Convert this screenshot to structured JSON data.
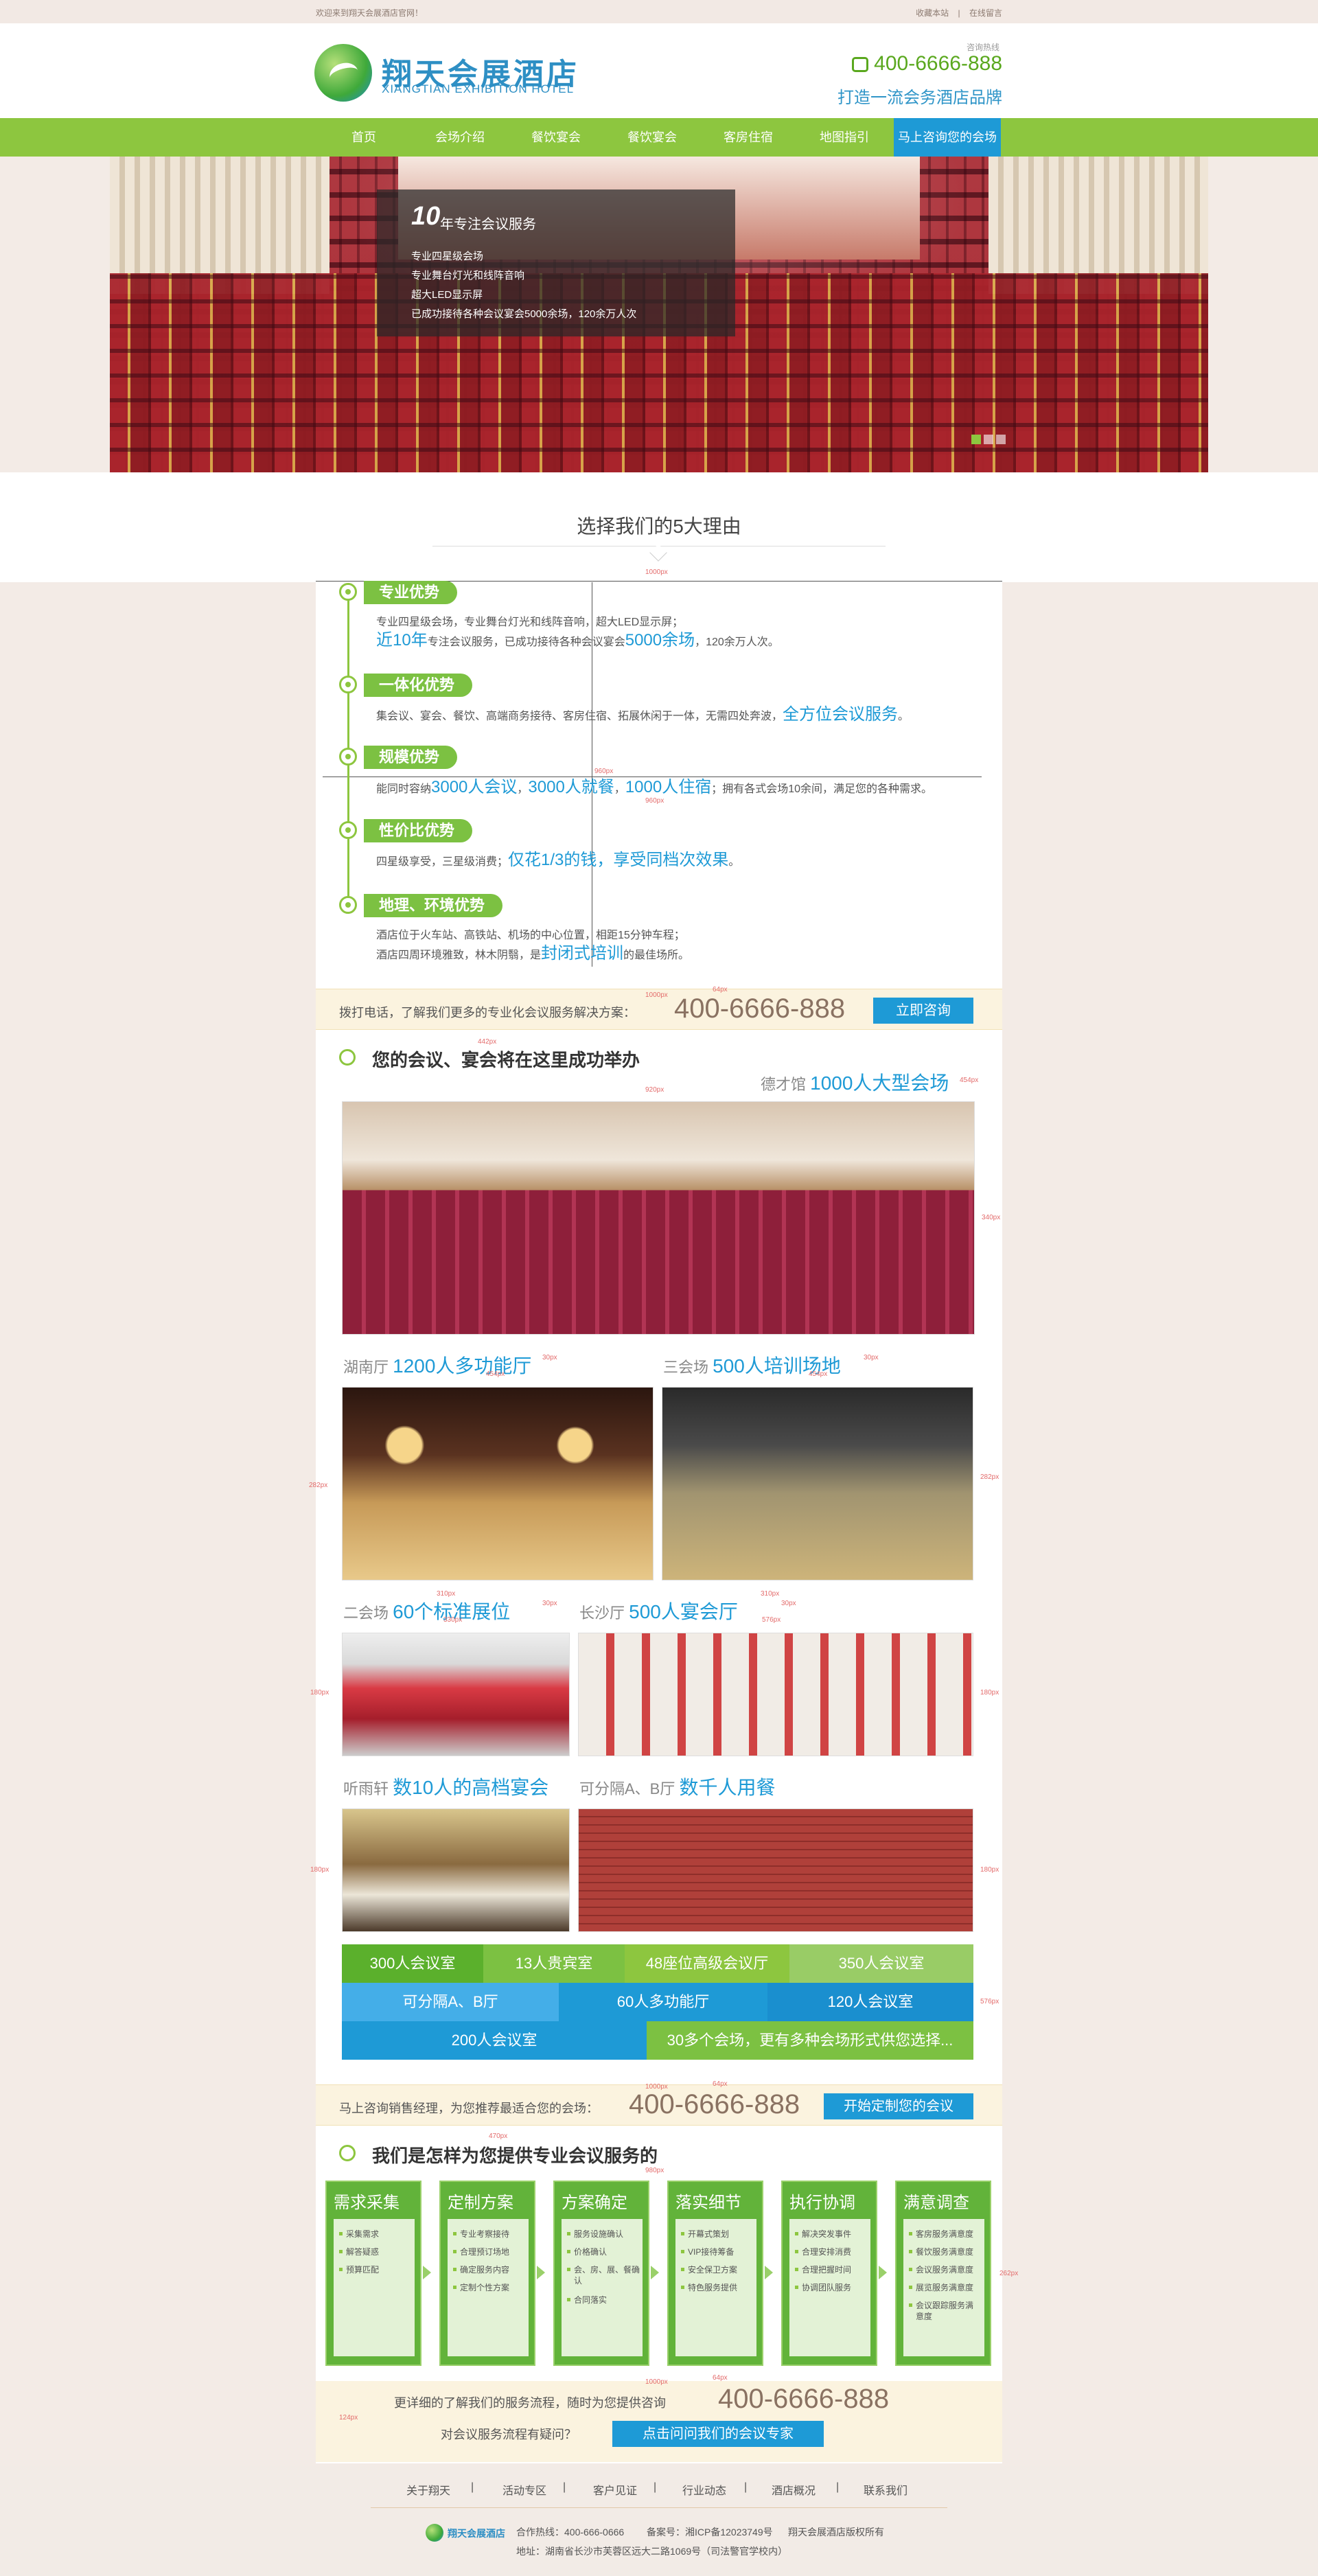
{
  "topbar": {
    "welcome": "欢迎来到翔天会展酒店官网！",
    "bookmark": "收藏本站",
    "sep": "|",
    "online": "在线留言"
  },
  "header": {
    "logo_cn": "翔天会展酒店",
    "logo_en": "XIANGTIAN EXHIBITION HOTEL",
    "hotline_label": "咨询热线",
    "hotline": "400-6666-888",
    "slogan": "打造一流会务酒店品牌"
  },
  "nav": [
    {
      "label": "首页"
    },
    {
      "label": "会场介绍"
    },
    {
      "label": "餐饮宴会"
    },
    {
      "label": "餐饮宴会"
    },
    {
      "label": "客房住宿"
    },
    {
      "label": "地图指引"
    },
    {
      "label": "马上咨询您的会场"
    }
  ],
  "banner": {
    "big": "10",
    "title": "年专注会议服务",
    "lines": [
      "专业四星级会场",
      "专业舞台灯光和线阵音响",
      "超大LED显示屏",
      "已成功接待各种会议宴会5000余场，120余万人次"
    ]
  },
  "reasons": {
    "title": "选择我们的5大理由",
    "items": [
      {
        "tag": "专业优势",
        "l1": "专业四星级会场，专业舞台灯光和线阵音响，超大LED显示屏；",
        "l2a": "近10年",
        "l2b": "专注会议服务，已成功接待各种会议宴会",
        "l2c": "5000余场",
        "l2d": "，120余万人次。"
      },
      {
        "tag": "一体化优势",
        "l1a": "集会议、宴会、餐饮、高端商务接待、客房住宿、拓展休闲于一体，无需四处奔波，",
        "l1b": "全方位会议服务",
        "l1c": "。"
      },
      {
        "tag": "规模优势",
        "l1a": "能同时容纳",
        "l1b": "3000人会议",
        "l1c": "，",
        "l1d": "3000人就餐",
        "l1e": "，",
        "l1f": "1000人住宿",
        "l1g": "；拥有各式会场10余间，满足您的各种需求。"
      },
      {
        "tag": "性价比优势",
        "l1a": "四星级享受，三星级消费；",
        "l1b": "仅花1/3的钱，享受同档次效果",
        "l1c": "。"
      },
      {
        "tag": "地理、环境优势",
        "l1": "酒店位于火车站、高铁站、机场的中心位置，相距15分钟车程；",
        "l2a": "酒店四周环境雅致，林木阴翳，是",
        "l2b": "封闭式培训",
        "l2c": "的最佳场所。"
      }
    ]
  },
  "strip1": {
    "text": "拨打电话，了解我们更多的专业化会议服务解决方案：",
    "num": "400-6666-888",
    "btn": "立即咨询"
  },
  "venues": {
    "title": "您的会议、宴会将在这里成功举办",
    "main": {
      "name": "德才馆",
      "desc": "1000人大型会场"
    },
    "v1": {
      "name": "湖南厅",
      "desc": "1200人多功能厅"
    },
    "v2": {
      "name": "三会场",
      "desc": "500人培训场地"
    },
    "v3": {
      "name": "二会场",
      "desc": "60个标准展位"
    },
    "v4": {
      "name": "长沙厅",
      "desc": "500人宴会厅"
    },
    "v5": {
      "name": "听雨轩",
      "desc": "数10人的高档宴会"
    },
    "v6": {
      "name": "可分隔A、B厅",
      "desc": "数千人用餐"
    },
    "grid": [
      [
        "300人会议室",
        "13人贵宾室",
        "48座位高级会议厅",
        "350人会议室"
      ],
      [
        "可分隔A、B厅",
        "60人多功能厅",
        "120人会议室"
      ],
      [
        "200人会议室",
        "30多个会场，更有多种会场形式供您选择..."
      ]
    ]
  },
  "strip2": {
    "text": "马上咨询销售经理，为您推荐最适合您的会场：",
    "num": "400-6666-888",
    "btn": "开始定制您的会议"
  },
  "process": {
    "title": "我们是怎样为您提供专业会议服务的",
    "steps": [
      {
        "h": "需求采集",
        "items": [
          "采集需求",
          "解答疑惑",
          "预算匹配"
        ]
      },
      {
        "h": "定制方案",
        "items": [
          "专业考察接待",
          "合理预订场地",
          "确定服务内容",
          "定制个性方案"
        ]
      },
      {
        "h": "方案确定",
        "items": [
          "服务设施确认",
          "价格确认",
          "会、房、展、餐确认",
          "合同落实"
        ]
      },
      {
        "h": "落实细节",
        "items": [
          "开幕式策划",
          "VIP接待筹备",
          "安全保卫方案",
          "特色服务提供"
        ]
      },
      {
        "h": "执行协调",
        "items": [
          "解决突发事件",
          "合理安排消费",
          "合理把握时间",
          "协调团队服务"
        ]
      },
      {
        "h": "满意调查",
        "items": [
          "客房服务满意度",
          "餐饮服务满意度",
          "会议服务满意度",
          "展览服务满意度",
          "会议跟踪服务满意度"
        ]
      }
    ]
  },
  "bottom_call": {
    "line1": "更详细的了解我们的服务流程，随时为您提供咨询",
    "num": "400-6666-888",
    "line2": "对会议服务流程有疑问？",
    "btn": "点击问问我们的会议专家"
  },
  "footer": {
    "links": [
      "关于翔天",
      "活动专区",
      "客户见证",
      "行业动态",
      "酒店概况",
      "联系我们"
    ],
    "sep": "|",
    "logo": "翔天会展酒店",
    "hotline": "合作热线：400-666-0666",
    "icp": "备案号：湘ICP备12023749号",
    "copyright": "翔天会展酒店版权所有",
    "address": "地址：湖南省长沙市芙蓉区远大二路1069号（司法警官学校内）"
  },
  "annotations": [
    "1000px",
    "64px",
    "960px",
    "920px",
    "442px",
    "340px",
    "454px",
    "30px",
    "282px",
    "310px",
    "576px",
    "330px",
    "180px",
    "470px",
    "980px",
    "262px",
    "124px"
  ],
  "colors": {
    "green": "#8dc63f",
    "blue": "#1e9ad6",
    "cream": "#fbf3df",
    "bg": "#f3ebe6"
  }
}
